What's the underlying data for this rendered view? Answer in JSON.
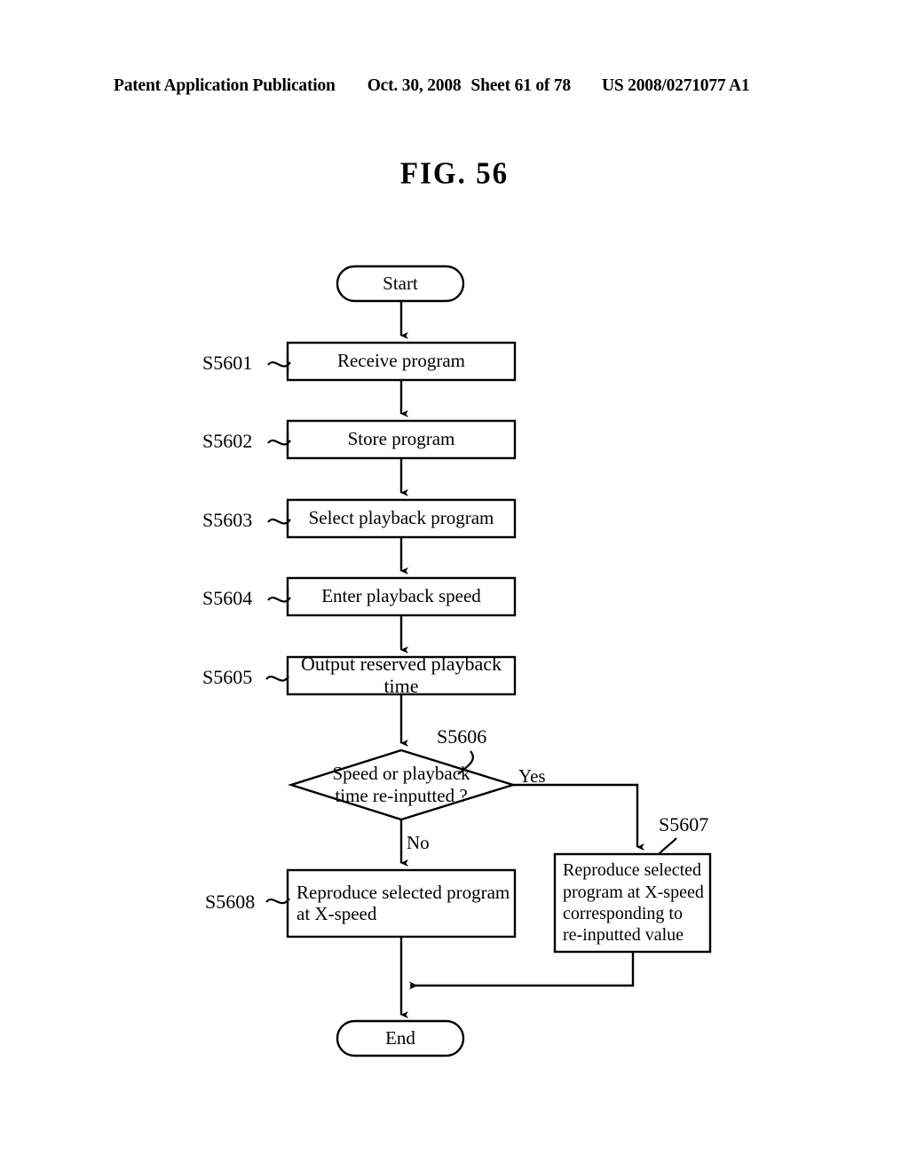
{
  "header": {
    "publication": "Patent Application Publication",
    "date": "Oct. 30, 2008",
    "sheet": "Sheet 61 of 78",
    "patent_number": "US 2008/0271077 A1"
  },
  "figure": {
    "title": "FIG. 56"
  },
  "flowchart": {
    "start_label": "Start",
    "end_label": "End",
    "steps": [
      {
        "id": "S5601",
        "text": "Receive program"
      },
      {
        "id": "S5602",
        "text": "Store program"
      },
      {
        "id": "S5603",
        "text": "Select playback program"
      },
      {
        "id": "S5604",
        "text": "Enter playback speed"
      },
      {
        "id": "S5605",
        "text": "Output reserved playback time"
      }
    ],
    "decision": {
      "id": "S5606",
      "text": "Speed or playback\ntime re-inputted ?",
      "yes_label": "Yes",
      "no_label": "No"
    },
    "branch_yes": {
      "id": "S5607",
      "text": "Reproduce selected\nprogram at X-speed\ncorresponding to\nre-inputted value"
    },
    "branch_no": {
      "id": "S5608",
      "text": "Reproduce selected program\nat X-speed"
    }
  }
}
